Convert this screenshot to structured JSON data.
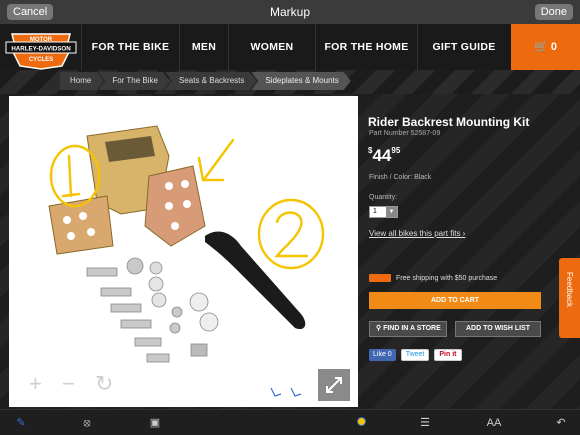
{
  "markup_bar": {
    "title": "Markup",
    "cancel_label": "Cancel",
    "done_label": "Done"
  },
  "nav": {
    "logo_top": "HARLEY-DAVIDSON",
    "logo_line1": "MOTOR",
    "logo_line2": "CYCLES",
    "items": [
      "FOR THE BIKE",
      "MEN",
      "WOMEN",
      "FOR THE HOME",
      "GIFT GUIDE"
    ],
    "cart_count": "0"
  },
  "breadcrumb": [
    "Home",
    "For The Bike",
    "Seats & Backrests",
    "Sideplates & Mounts"
  ],
  "product": {
    "title": "Rider Backrest Mounting Kit",
    "part_number": "Part Number  52587-09",
    "price_dollars": "44",
    "price_cents": "95",
    "price_symbol": "$",
    "finish": "Finish / Color:  Black",
    "quantity_label": "Quantity:",
    "quantity_value": "1",
    "view_all": "View all bikes this part fits",
    "shipping": "Free shipping with $50 purchase",
    "add_to_cart": "ADD TO CART",
    "find_store": "FIND IN A STORE",
    "wish_list": "ADD TO WISH LIST"
  },
  "social": {
    "facebook": "Like 0",
    "twitter": "Tweet",
    "pinterest": "Pin it"
  },
  "annotations": {
    "circle1": "1",
    "circle2": "2"
  },
  "feedback_label": "Feedback",
  "colors": {
    "accent": "#ee6a0f",
    "annotation": "#f5c400",
    "markup_ink": "#3a6fd8"
  },
  "toolbar_icons": [
    "pen-icon",
    "shapes-icon",
    "text-box-icon",
    "color-dot-icon",
    "line-width-icon",
    "font-size-icon",
    "undo-icon"
  ],
  "toolbar_font_label": "AA"
}
